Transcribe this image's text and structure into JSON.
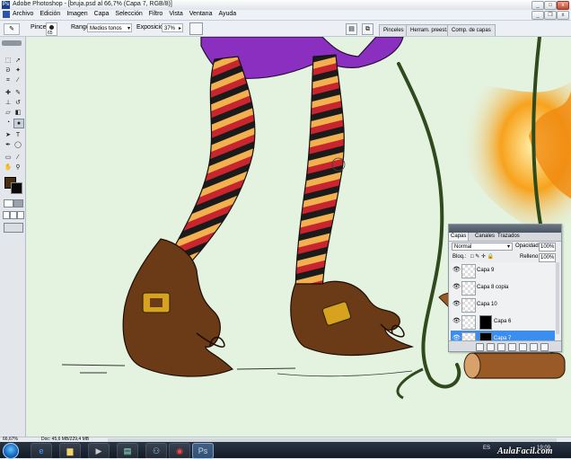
{
  "window": {
    "title": "Adobe Photoshop - [bruja.psd al 66,7% (Capa 7, RGB/8)]",
    "controls": {
      "minimize": "_",
      "maximize": "□",
      "close": "x"
    },
    "document_controls": {
      "minimize": "_",
      "restore": "❐",
      "close": "x"
    }
  },
  "menu": [
    "Archivo",
    "Edición",
    "Imagen",
    "Capa",
    "Selección",
    "Filtro",
    "Vista",
    "Ventana",
    "Ayuda"
  ],
  "options_bar": {
    "brush_label": "Pincel:",
    "brush_size": "65",
    "range_label": "Rango:",
    "range_value": "Medios tonos",
    "exposure_label": "Exposición:",
    "exposure_value": "37%",
    "panel_tabs": [
      "Pinceles",
      "Herram. preest.",
      "Comp. de capas"
    ]
  },
  "layers_panel": {
    "tabs": [
      "Capas",
      "Canales",
      "Trazados"
    ],
    "blend_mode": "Normal",
    "opacity_label": "Opacidad:",
    "opacity_value": "100%",
    "lock_label": "Bloq.:",
    "fill_label": "Relleno:",
    "fill_value": "100%",
    "layers": [
      {
        "name": "Capa 9",
        "selected": false
      },
      {
        "name": "Capa 8 copia",
        "selected": false
      },
      {
        "name": "Capa 10",
        "selected": false
      },
      {
        "name": "Capa 6",
        "selected": false
      },
      {
        "name": "Capa 7",
        "selected": true
      }
    ]
  },
  "status": {
    "zoom": "66,67%",
    "doc": "Doc: 45,6 MB/229,4 MB"
  },
  "taskbar": {
    "language": "ES",
    "time": "19:09"
  },
  "watermark": "AulaFacil.com",
  "colors": {
    "foreground": "#4a2e12",
    "background": "#0a0a0a",
    "canvas": "#e4f3e0",
    "selected_layer": "#3a8ef0"
  }
}
